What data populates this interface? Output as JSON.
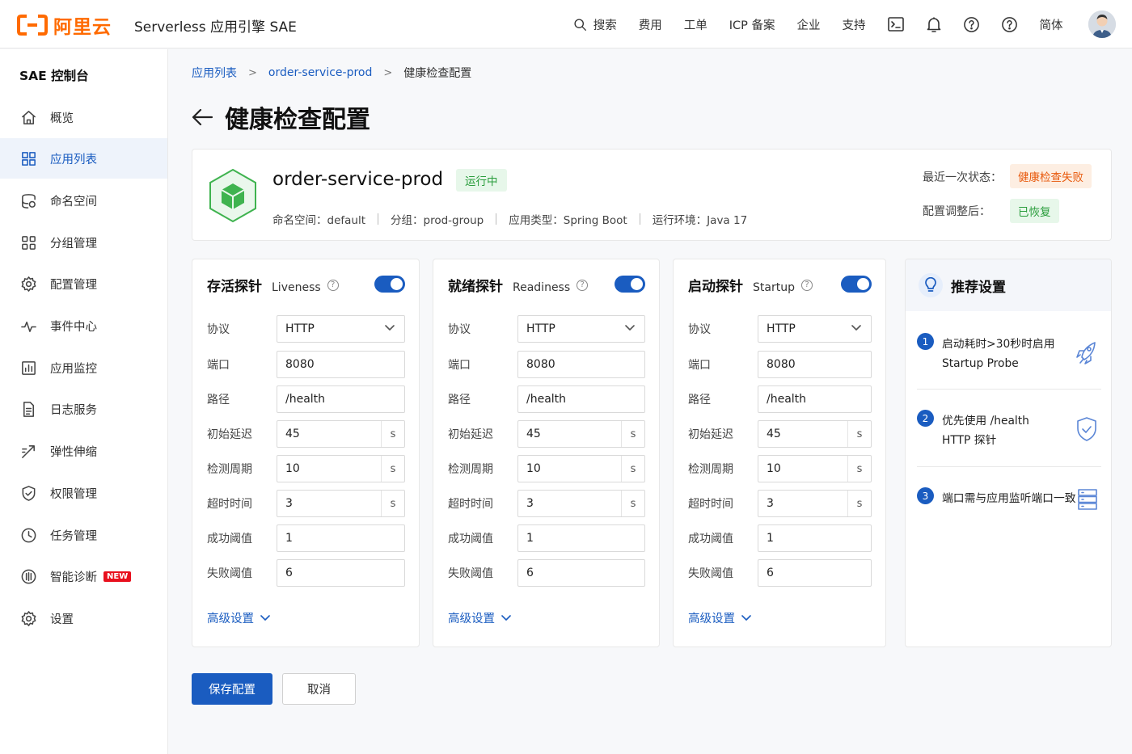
{
  "header": {
    "brand": "阿里云",
    "product": "Serverless 应用引擎 SAE",
    "nav": [
      "搜索",
      "费用",
      "工单",
      "ICP 备案",
      "企业",
      "支持"
    ],
    "lang": "简体"
  },
  "sidebar": {
    "title": "SAE 控制台",
    "items": [
      {
        "label": "概览",
        "icon": "home-icon"
      },
      {
        "label": "应用列表",
        "icon": "apps-grid-icon",
        "active": true
      },
      {
        "label": "命名空间",
        "icon": "namespace-icon"
      },
      {
        "label": "分组管理",
        "icon": "group-icon"
      },
      {
        "label": "配置管理",
        "icon": "gear-icon"
      },
      {
        "label": "事件中心",
        "icon": "pulse-icon"
      },
      {
        "label": "应用监控",
        "icon": "monitor-chart-icon"
      },
      {
        "label": "日志服务",
        "icon": "log-file-icon"
      },
      {
        "label": "弹性伸缩",
        "icon": "scale-icon"
      },
      {
        "label": "权限管理",
        "icon": "shield-icon"
      },
      {
        "label": "任务管理",
        "icon": "clock-icon"
      },
      {
        "label": "智能诊断",
        "icon": "diagnosis-icon",
        "badge": "NEW"
      },
      {
        "label": "设置",
        "icon": "settings-icon"
      }
    ]
  },
  "breadcrumb": [
    "应用列表",
    "order-service-prod",
    "健康检查配置"
  ],
  "page": {
    "title": "健康检查配置"
  },
  "app": {
    "name": "order-service-prod",
    "status": "运行中",
    "namespace": "命名空间：default",
    "group": "分组：prod-group",
    "type": "应用类型：Spring Boot",
    "env": "运行环境：Java 17",
    "last_status_label": "最近一次状态：",
    "last_status_value": "健康检查失败",
    "after_label": "配置调整后：",
    "after_value": "已恢复"
  },
  "probes": [
    {
      "zh": "存活探针",
      "en": "Liveness",
      "enabled": true,
      "fields": {
        "protocol": "HTTP",
        "port": "8080",
        "path": "/health",
        "initial_delay": "45",
        "period": "10",
        "timeout": "3",
        "success": "1",
        "failure": "6"
      }
    },
    {
      "zh": "就绪探针",
      "en": "Readiness",
      "enabled": true,
      "fields": {
        "protocol": "HTTP",
        "port": "8080",
        "path": "/health",
        "initial_delay": "45",
        "period": "10",
        "timeout": "3",
        "success": "1",
        "failure": "6"
      }
    },
    {
      "zh": "启动探针",
      "en": "Startup",
      "enabled": true,
      "fields": {
        "protocol": "HTTP",
        "port": "8080",
        "path": "/health",
        "initial_delay": "45",
        "period": "10",
        "timeout": "3",
        "success": "1",
        "failure": "6"
      }
    }
  ],
  "field_labels": {
    "protocol": "协议",
    "port": "端口",
    "path": "路径",
    "initial_delay": "初始延迟",
    "period": "检测周期",
    "timeout": "超时时间",
    "success": "成功阈值",
    "failure": "失败阈值"
  },
  "unit": "s",
  "advanced_label": "高级设置",
  "recommend": {
    "title": "推荐设置",
    "items": [
      {
        "num": "1",
        "line1": "启动耗时>30秒时启用",
        "line2": "Startup Probe",
        "icon": "rocket-icon"
      },
      {
        "num": "2",
        "line1": "优先使用 /health",
        "line2": "HTTP 探针",
        "icon": "shield-check-icon"
      },
      {
        "num": "3",
        "line1": "端口需与应用监听端口一致",
        "line2": "",
        "icon": "server-icon"
      }
    ]
  },
  "actions": {
    "save": "保存配置",
    "cancel": "取消"
  },
  "colors": {
    "primary": "#1a5cc0",
    "brand": "#ff6a00",
    "success": "#2a9d3c",
    "danger": "#e8590c"
  }
}
